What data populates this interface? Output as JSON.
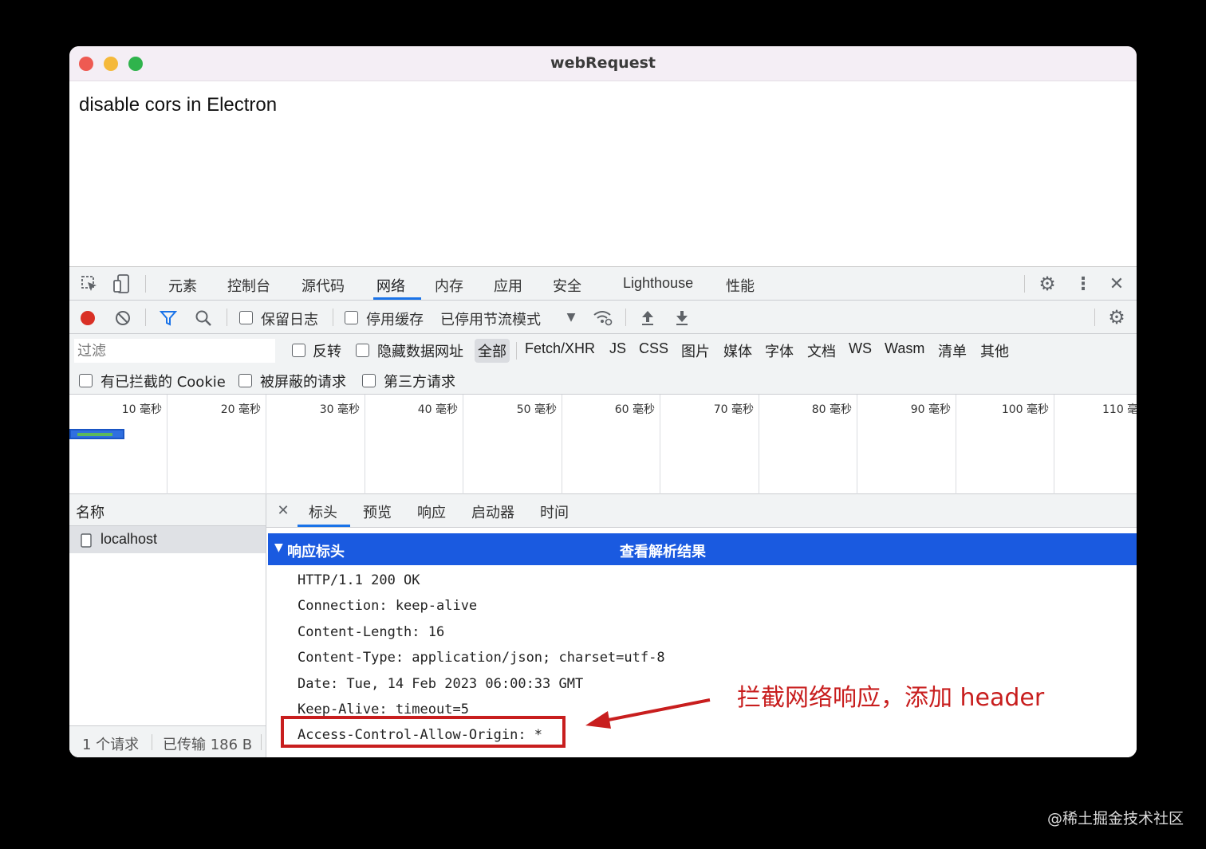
{
  "window": {
    "title": "webRequest",
    "page_text": "disable cors in Electron"
  },
  "devtools": {
    "tabs": [
      "元素",
      "控制台",
      "源代码",
      "网络",
      "内存",
      "应用",
      "安全",
      "Lighthouse",
      "性能"
    ],
    "active_tab": "网络",
    "toolbar": {
      "preserve_log": "保留日志",
      "disable_cache": "停用缓存",
      "throttling": "已停用节流模式"
    },
    "filter": {
      "placeholder": "过滤",
      "invert": "反转",
      "hide_data_urls": "隐藏数据网址",
      "types": [
        "全部",
        "Fetch/XHR",
        "JS",
        "CSS",
        "图片",
        "媒体",
        "字体",
        "文档",
        "WS",
        "Wasm",
        "清单",
        "其他"
      ],
      "blocked_cookies": "有已拦截的 Cookie",
      "blocked_requests": "被屏蔽的请求",
      "third_party": "第三方请求"
    },
    "timeline_ticks": [
      "10 毫秒",
      "20 毫秒",
      "30 毫秒",
      "40 毫秒",
      "50 毫秒",
      "60 毫秒",
      "70 毫秒",
      "80 毫秒",
      "90 毫秒",
      "100 毫秒",
      "110 毫"
    ],
    "requests": {
      "header": "名称",
      "rows": [
        "localhost"
      ],
      "footer_count": "1 个请求",
      "footer_transferred": "已传输 186 B"
    },
    "detail": {
      "tabs": [
        "标头",
        "预览",
        "响应",
        "启动器",
        "时间"
      ],
      "section_title": "响应标头",
      "section_link": "查看解析结果",
      "headers": [
        "HTTP/1.1 200 OK",
        "Connection: keep-alive",
        "Content-Length: 16",
        "Content-Type: application/json; charset=utf-8",
        "Date: Tue, 14 Feb 2023 06:00:33 GMT",
        "Keep-Alive: timeout=5",
        "Access-Control-Allow-Origin: *"
      ]
    }
  },
  "annotation": {
    "text": "拦截网络响应，添加 header",
    "color": "#c81e1e"
  },
  "watermark": "@稀土掘金技术社区"
}
